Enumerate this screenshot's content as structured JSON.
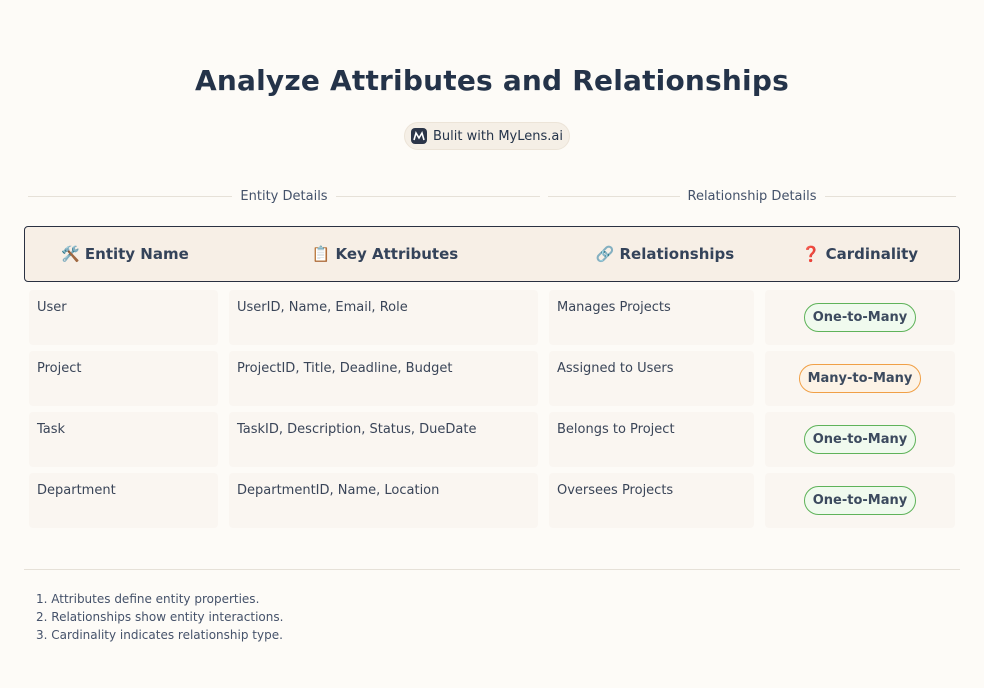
{
  "title": "Analyze Attributes and Relationships",
  "badge": {
    "text": "Bulit with MyLens.ai",
    "icon": "mylens-logo-icon"
  },
  "sections": {
    "entity": "Entity Details",
    "relationship": "Relationship Details"
  },
  "columns": [
    {
      "label": "Entity Name",
      "icon": "🛠️",
      "icon_name": "tools-icon"
    },
    {
      "label": "Key Attributes",
      "icon": "📋",
      "icon_name": "clipboard-icon"
    },
    {
      "label": "Relationships",
      "icon": "🔗",
      "icon_name": "link-icon"
    },
    {
      "label": "Cardinality",
      "icon": "❓",
      "icon_name": "question-icon"
    }
  ],
  "rows": [
    {
      "entity": "User",
      "attributes": "UserID, Name, Email, Role",
      "relationship": "Manages Projects",
      "cardinality": "One-to-Many",
      "color": "green"
    },
    {
      "entity": "Project",
      "attributes": "ProjectID, Title, Deadline, Budget",
      "relationship": "Assigned to Users",
      "cardinality": "Many-to-Many",
      "color": "orange"
    },
    {
      "entity": "Task",
      "attributes": "TaskID, Description, Status, DueDate",
      "relationship": "Belongs to Project",
      "cardinality": "One-to-Many",
      "color": "green"
    },
    {
      "entity": "Department",
      "attributes": "DepartmentID, Name, Location",
      "relationship": "Oversees Projects",
      "cardinality": "One-to-Many",
      "color": "green"
    }
  ],
  "colors": {
    "green": "#5fb35a",
    "orange": "#f0a047",
    "header_bg": "#f7efe6",
    "title": "#243349"
  },
  "notes": [
    "1. Attributes define entity properties.",
    "2. Relationships show entity interactions.",
    "3. Cardinality indicates relationship type."
  ]
}
